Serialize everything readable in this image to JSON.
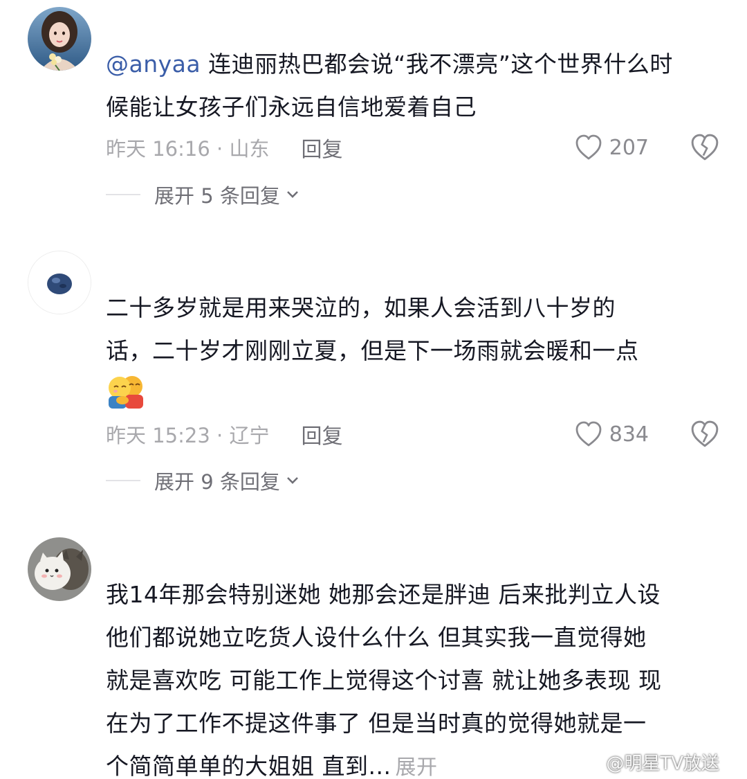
{
  "comments": [
    {
      "username": "@anyaa",
      "line1": "连迪丽热巴都会说“我不漂亮”这个世界什么时",
      "line2": "候能让女孩子们永远自信地爱着自己",
      "meta": "昨天 16:16 · 山东",
      "reply_label": "回复",
      "likes": "207",
      "expand_label": "展开 5 条回复"
    },
    {
      "line1": "二十多岁就是用来哭泣的，如果人会活到八十岁的",
      "line2": "话，二十岁才刚刚立夏，但是下一场雨就会暖和一点",
      "emoji": "hug-emoji",
      "meta": "昨天 15:23 · 辽宁",
      "reply_label": "回复",
      "likes": "834",
      "expand_label": "展开 9 条回复"
    },
    {
      "line1": "我14年那会特别迷她 她那会还是胖迪 后来批判立人设",
      "line2": "他们都说她立吃货人设什么什么 但其实我一直觉得她",
      "line3": "就是喜欢吃 可能工作上觉得这个讨喜 就让她多表现 现",
      "line4": "在为了工作不提这件事了 但是当时真的觉得她就是一",
      "line5": "个简简单单的大姐姐 直到...",
      "expand_inline": "展开"
    }
  ],
  "watermark": "@明星TV放送",
  "colors": {
    "text": "#161823",
    "mention": "#3a5da8",
    "meta": "#a8a8ac",
    "icon": "#8a8a8f"
  },
  "icons": [
    "heart-icon",
    "broken-heart-icon",
    "chevron-down-icon",
    "weibo-icon"
  ]
}
